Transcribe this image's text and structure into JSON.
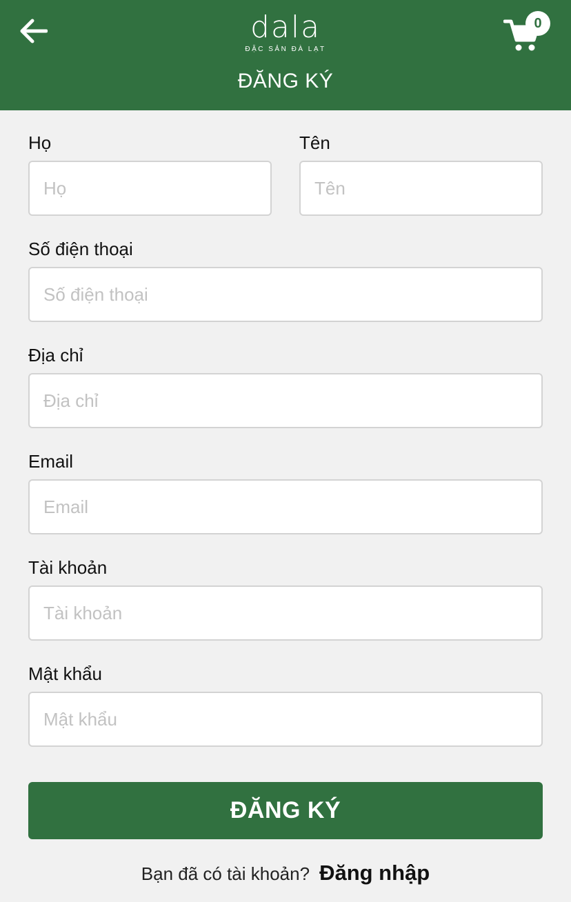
{
  "header": {
    "logo_text": "dala",
    "logo_subtitle": "ĐẶC SẢN ĐÀ LẠT",
    "title": "ĐĂNG KÝ",
    "cart_count": "0",
    "back_icon": "arrow-left-icon",
    "cart_icon": "shopping-cart-icon"
  },
  "form": {
    "ho": {
      "label": "Họ",
      "placeholder": "Họ"
    },
    "ten": {
      "label": "Tên",
      "placeholder": "Tên"
    },
    "phone": {
      "label": "Số điện thoại",
      "placeholder": "Số điện thoại"
    },
    "address": {
      "label": "Địa chỉ",
      "placeholder": "Địa chỉ"
    },
    "email": {
      "label": "Email",
      "placeholder": "Email"
    },
    "username": {
      "label": "Tài khoản",
      "placeholder": "Tài khoản"
    },
    "password": {
      "label": "Mật khẩu",
      "placeholder": "Mật khẩu"
    },
    "submit_label": "ĐĂNG KÝ"
  },
  "footer": {
    "question": "Bạn đã có tài khoản?",
    "login_link": "Đăng nhập"
  },
  "colors": {
    "brand_green": "#317140",
    "background": "#f1f1f1",
    "input_border": "#d3d3d3",
    "placeholder": "#c2c2c2"
  }
}
